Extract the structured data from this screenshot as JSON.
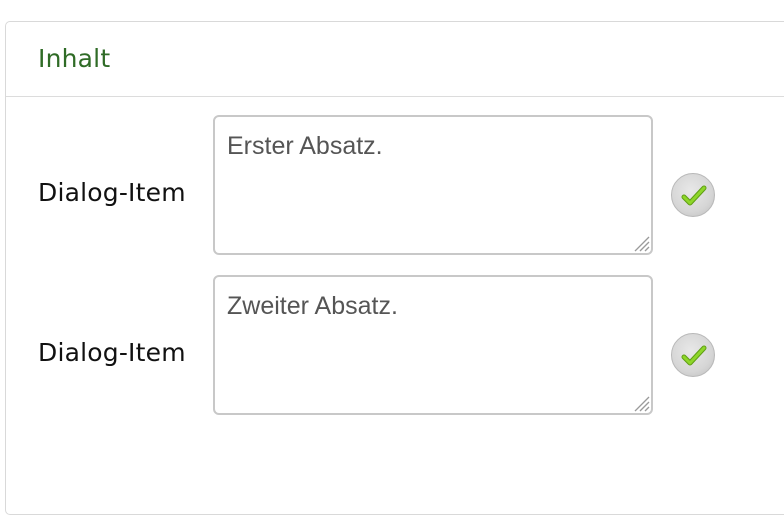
{
  "panel": {
    "title": "Inhalt"
  },
  "items": [
    {
      "label": "Dialog-Item",
      "value": "Erster Absatz."
    },
    {
      "label": "Dialog-Item",
      "value": "Zweiter Absatz."
    }
  ],
  "icons": {
    "confirm": "checkmark-icon",
    "resize": "resize-grip-icon"
  },
  "colors": {
    "title": "#2f6b26",
    "checkmark": "#7ac41d",
    "border": "#c8c8c8"
  }
}
